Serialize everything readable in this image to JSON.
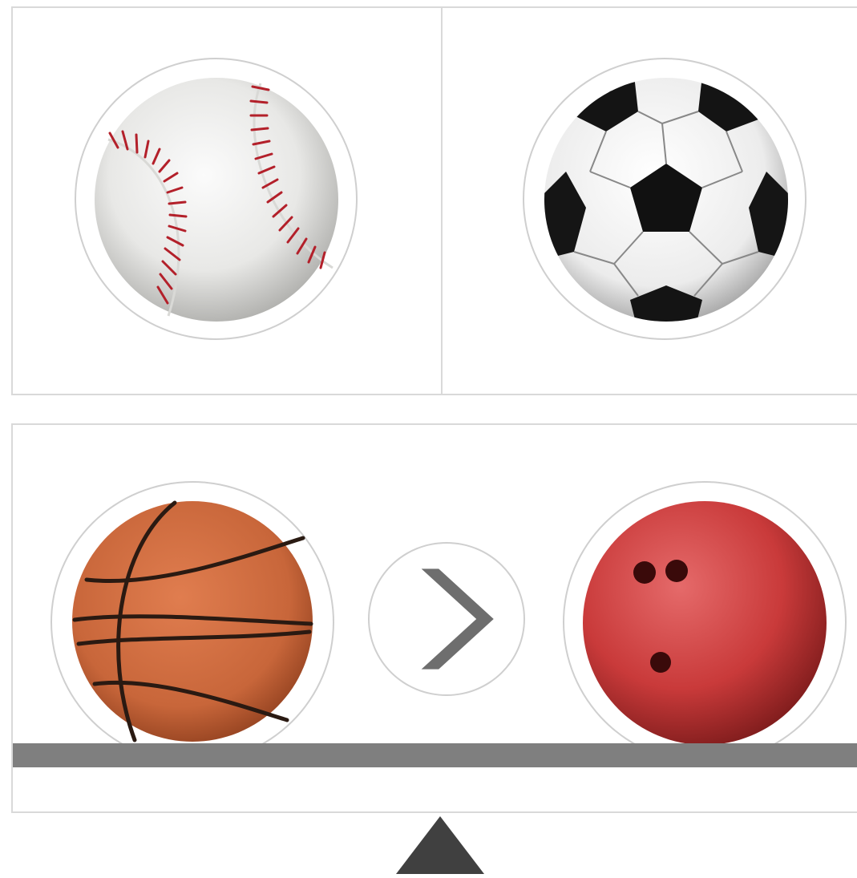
{
  "scene": {
    "top_pair": [
      "baseball",
      "soccer-ball"
    ],
    "balance_left": "basketball",
    "balance_right": "bowling-ball",
    "comparison_symbol": "greater-than-chevron-icon",
    "pivot_icon": "triangle-fulcrum-icon"
  },
  "colors": {
    "panel_border": "#d9d9d9",
    "ring_border": "#cfcfcf",
    "beam": "#7f7f7f",
    "chevron": "#6e6e6e",
    "fulcrum": "#404040",
    "basketball": "#c8663a",
    "bowling_ball": "#c93a3a",
    "baseball_stitch": "#b3202a"
  }
}
